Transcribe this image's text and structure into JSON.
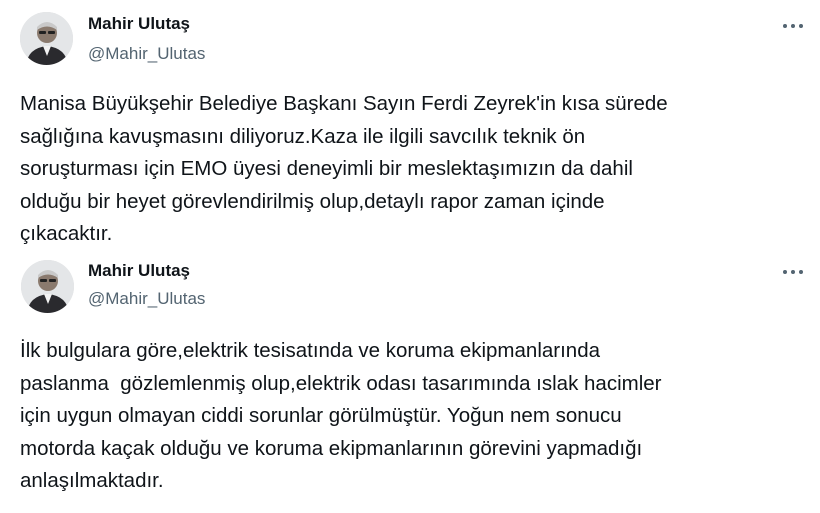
{
  "tweets": [
    {
      "author": {
        "display_name": "Mahir Ulutaş",
        "handle": "@Mahir_Ulutas",
        "avatar_icon": "user-avatar"
      },
      "more_icon": "more-options-icon",
      "text": "Manisa Büyükşehir Belediye Başkanı Sayın Ferdi Zeyrek'in kısa sürede\nsağlığına kavuşmasını diliyoruz.Kaza ile ilgili savcılık teknik ön\nsoruşturması için EMO üyesi deneyimli bir meslektaşımızın da dahil\nolduğu bir heyet görevlendirilmiş olup,detaylı rapor zaman içinde\nçıkacaktır."
    },
    {
      "author": {
        "display_name": "Mahir Ulutaş",
        "handle": "@Mahir_Ulutas",
        "avatar_icon": "user-avatar"
      },
      "more_icon": "more-options-icon",
      "text": "İlk bulgulara göre,elektrik tesisatında ve koruma ekipmanlarında\npaslanma  gözlemlenmiş olup,elektrik odası tasarımında ıslak hacimler\niçin uygun olmayan ciddi sorunlar görülmüştür. Yoğun nem sonucu\nmotorda kaçak olduğu ve koruma ekipmanlarının görevini yapmadığı\nanlaşılmaktadır."
    }
  ],
  "colors": {
    "text_primary": "#0f1419",
    "text_secondary": "#536471",
    "background": "#ffffff"
  }
}
